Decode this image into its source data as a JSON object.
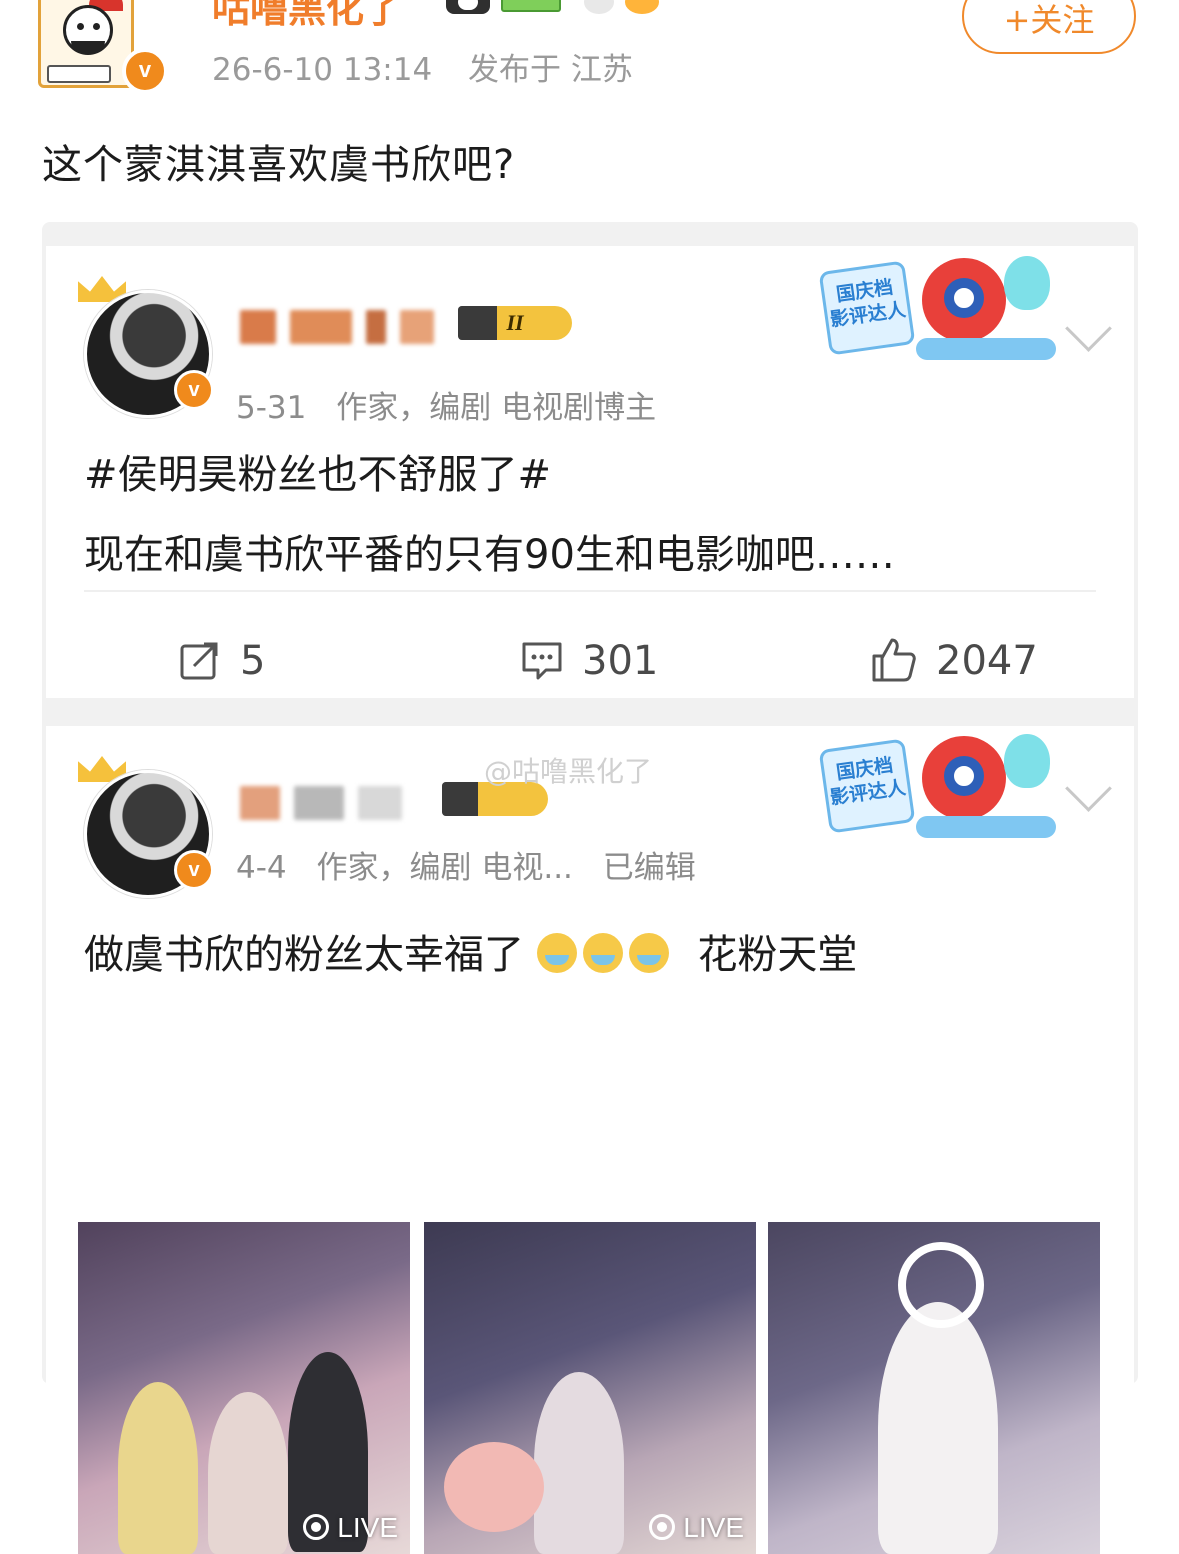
{
  "author": {
    "name": "咕噜黑化了",
    "date": "26-6-10 13:14",
    "location": "发布于 江苏",
    "follow_label": "+关注",
    "verified_mark": "v",
    "badges": [
      "panda-badge",
      "level-badge",
      "panda-face-badge",
      "sun-badge"
    ]
  },
  "post": {
    "text": "这个蒙淇淇喜欢虞书欣吧?"
  },
  "quoted_posts": [
    {
      "level_badge": "II",
      "verified_mark": "v",
      "date": "5-31",
      "bio": "作家，编剧 电视剧博主",
      "hashtag": "#侯明昊粉丝也不舒服了#",
      "text": "现在和虞书欣平番的只有90生和电影咖吧……",
      "sticker": {
        "line1": "国庆档",
        "line2": "影评达人"
      },
      "actions": {
        "repost": "5",
        "comment": "301",
        "like": "2047"
      }
    },
    {
      "verified_mark": "v",
      "date": "4-4",
      "bio": "作家，编剧 电视...",
      "edited": "已编辑",
      "watermark": "@咕噜黑化了",
      "text_before": "做虞书欣的粉丝太幸福了",
      "text_after": "花粉天堂",
      "emoji": "crying-face-emoji",
      "sticker": {
        "line1": "国庆档",
        "line2": "影评达人"
      },
      "images": [
        {
          "badge": "LIVE"
        },
        {
          "badge": "LIVE"
        },
        {
          "badge": ""
        }
      ]
    }
  ],
  "colors": {
    "accent": "#f07d2b",
    "verified": "#f08a1c",
    "meta": "#8c8c8c"
  }
}
